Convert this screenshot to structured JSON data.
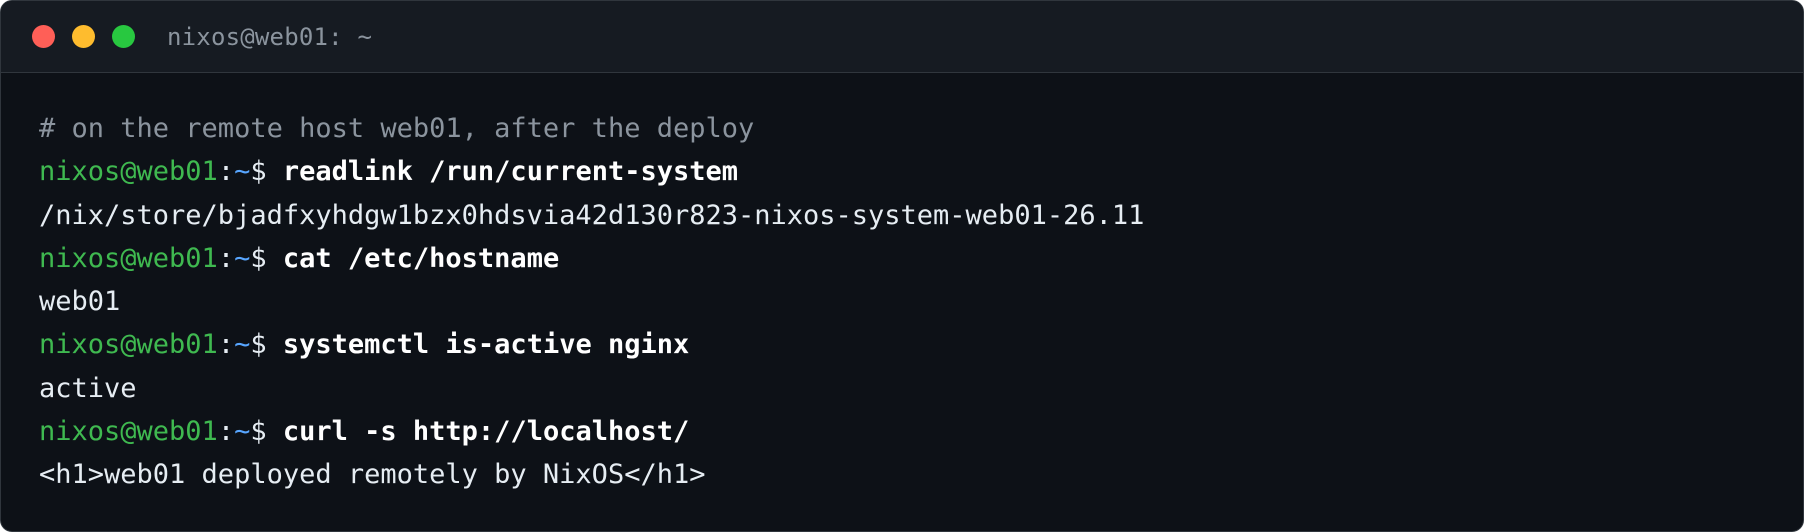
{
  "window": {
    "title": "nixos@web01: ~",
    "controls": {
      "close_color": "#ff5f57",
      "minimize_color": "#febc2e",
      "maximize_color": "#28c840"
    }
  },
  "colors": {
    "background": "#0d1117",
    "titlebar": "#161b22",
    "prompt_user": "#3fb950",
    "prompt_path": "#58a6ff",
    "comment": "#8b949e",
    "text": "#e6edf3"
  },
  "terminal": {
    "comment": "# on the remote host web01, after the deploy",
    "entries": [
      {
        "prompt_user": "nixos@web01",
        "prompt_sep": ":",
        "prompt_path": "~",
        "prompt_symbol": "$ ",
        "command": "readlink /run/current-system",
        "output": "/nix/store/bjadfxyhdgw1bzx0hdsvia42d130r823-nixos-system-web01-26.11"
      },
      {
        "prompt_user": "nixos@web01",
        "prompt_sep": ":",
        "prompt_path": "~",
        "prompt_symbol": "$ ",
        "command": "cat /etc/hostname",
        "output": "web01"
      },
      {
        "prompt_user": "nixos@web01",
        "prompt_sep": ":",
        "prompt_path": "~",
        "prompt_symbol": "$ ",
        "command": "systemctl is-active nginx",
        "output": "active"
      },
      {
        "prompt_user": "nixos@web01",
        "prompt_sep": ":",
        "prompt_path": "~",
        "prompt_symbol": "$ ",
        "command": "curl -s http://localhost/",
        "output": "<h1>web01 deployed remotely by NixOS</h1>"
      }
    ]
  }
}
